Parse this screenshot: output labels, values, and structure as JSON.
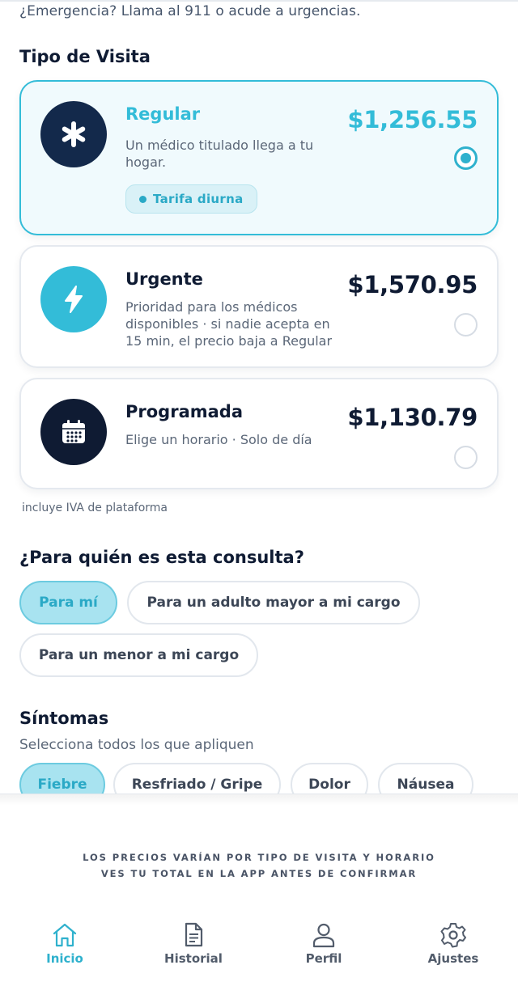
{
  "emergency_text": "¿Emergencia? Llama al 911 o acude a urgencias.",
  "visit_type": {
    "title": "Tipo de Visita",
    "options": [
      {
        "name": "Regular",
        "description": "Un médico titulado llega a tu hogar.",
        "price": "$1,256.55",
        "badge": "Tarifa diurna",
        "icon": "asterisk-icon",
        "selected": true,
        "color": "#33bcd8"
      },
      {
        "name": "Urgente",
        "description": "Prioridad para los médicos disponibles · si nadie acepta en 15 min, el precio baja a Regular",
        "price": "$1,570.95",
        "icon": "lightning-icon",
        "selected": false
      },
      {
        "name": "Programada",
        "description": "Elige un horario · Solo de día",
        "price": "$1,130.79",
        "icon": "calendar-icon",
        "selected": false
      }
    ],
    "tax_note": "incluye IVA de plataforma"
  },
  "recipient": {
    "title": "¿Para quién es esta consulta?",
    "options": [
      "Para mí",
      "Para un adulto mayor a mi cargo",
      "Para un menor a mi cargo"
    ],
    "selected": "Para mí"
  },
  "symptoms": {
    "title": "Síntomas",
    "subtitle": "Selecciona todos los que apliquen",
    "options": [
      "Fiebre",
      "Resfriado / Gripe",
      "Dolor",
      "Náusea"
    ],
    "selected": [
      "Fiebre"
    ]
  },
  "footer": {
    "line1": "LOS PRECIOS VARÍAN POR TIPO DE VISITA Y HORARIO",
    "line2": "VES TU TOTAL EN LA APP ANTES DE CONFIRMAR"
  },
  "nav": {
    "items": [
      {
        "label": "Inicio",
        "icon": "home-icon",
        "active": true
      },
      {
        "label": "Historial",
        "icon": "document-icon",
        "active": false
      },
      {
        "label": "Perfil",
        "icon": "user-icon",
        "active": false
      },
      {
        "label": "Ajustes",
        "icon": "gear-icon",
        "active": false
      }
    ]
  },
  "colors": {
    "accent": "#2fb1cd",
    "navy": "#0f1b33",
    "selected_chip_bg": "#a8e3f0"
  }
}
